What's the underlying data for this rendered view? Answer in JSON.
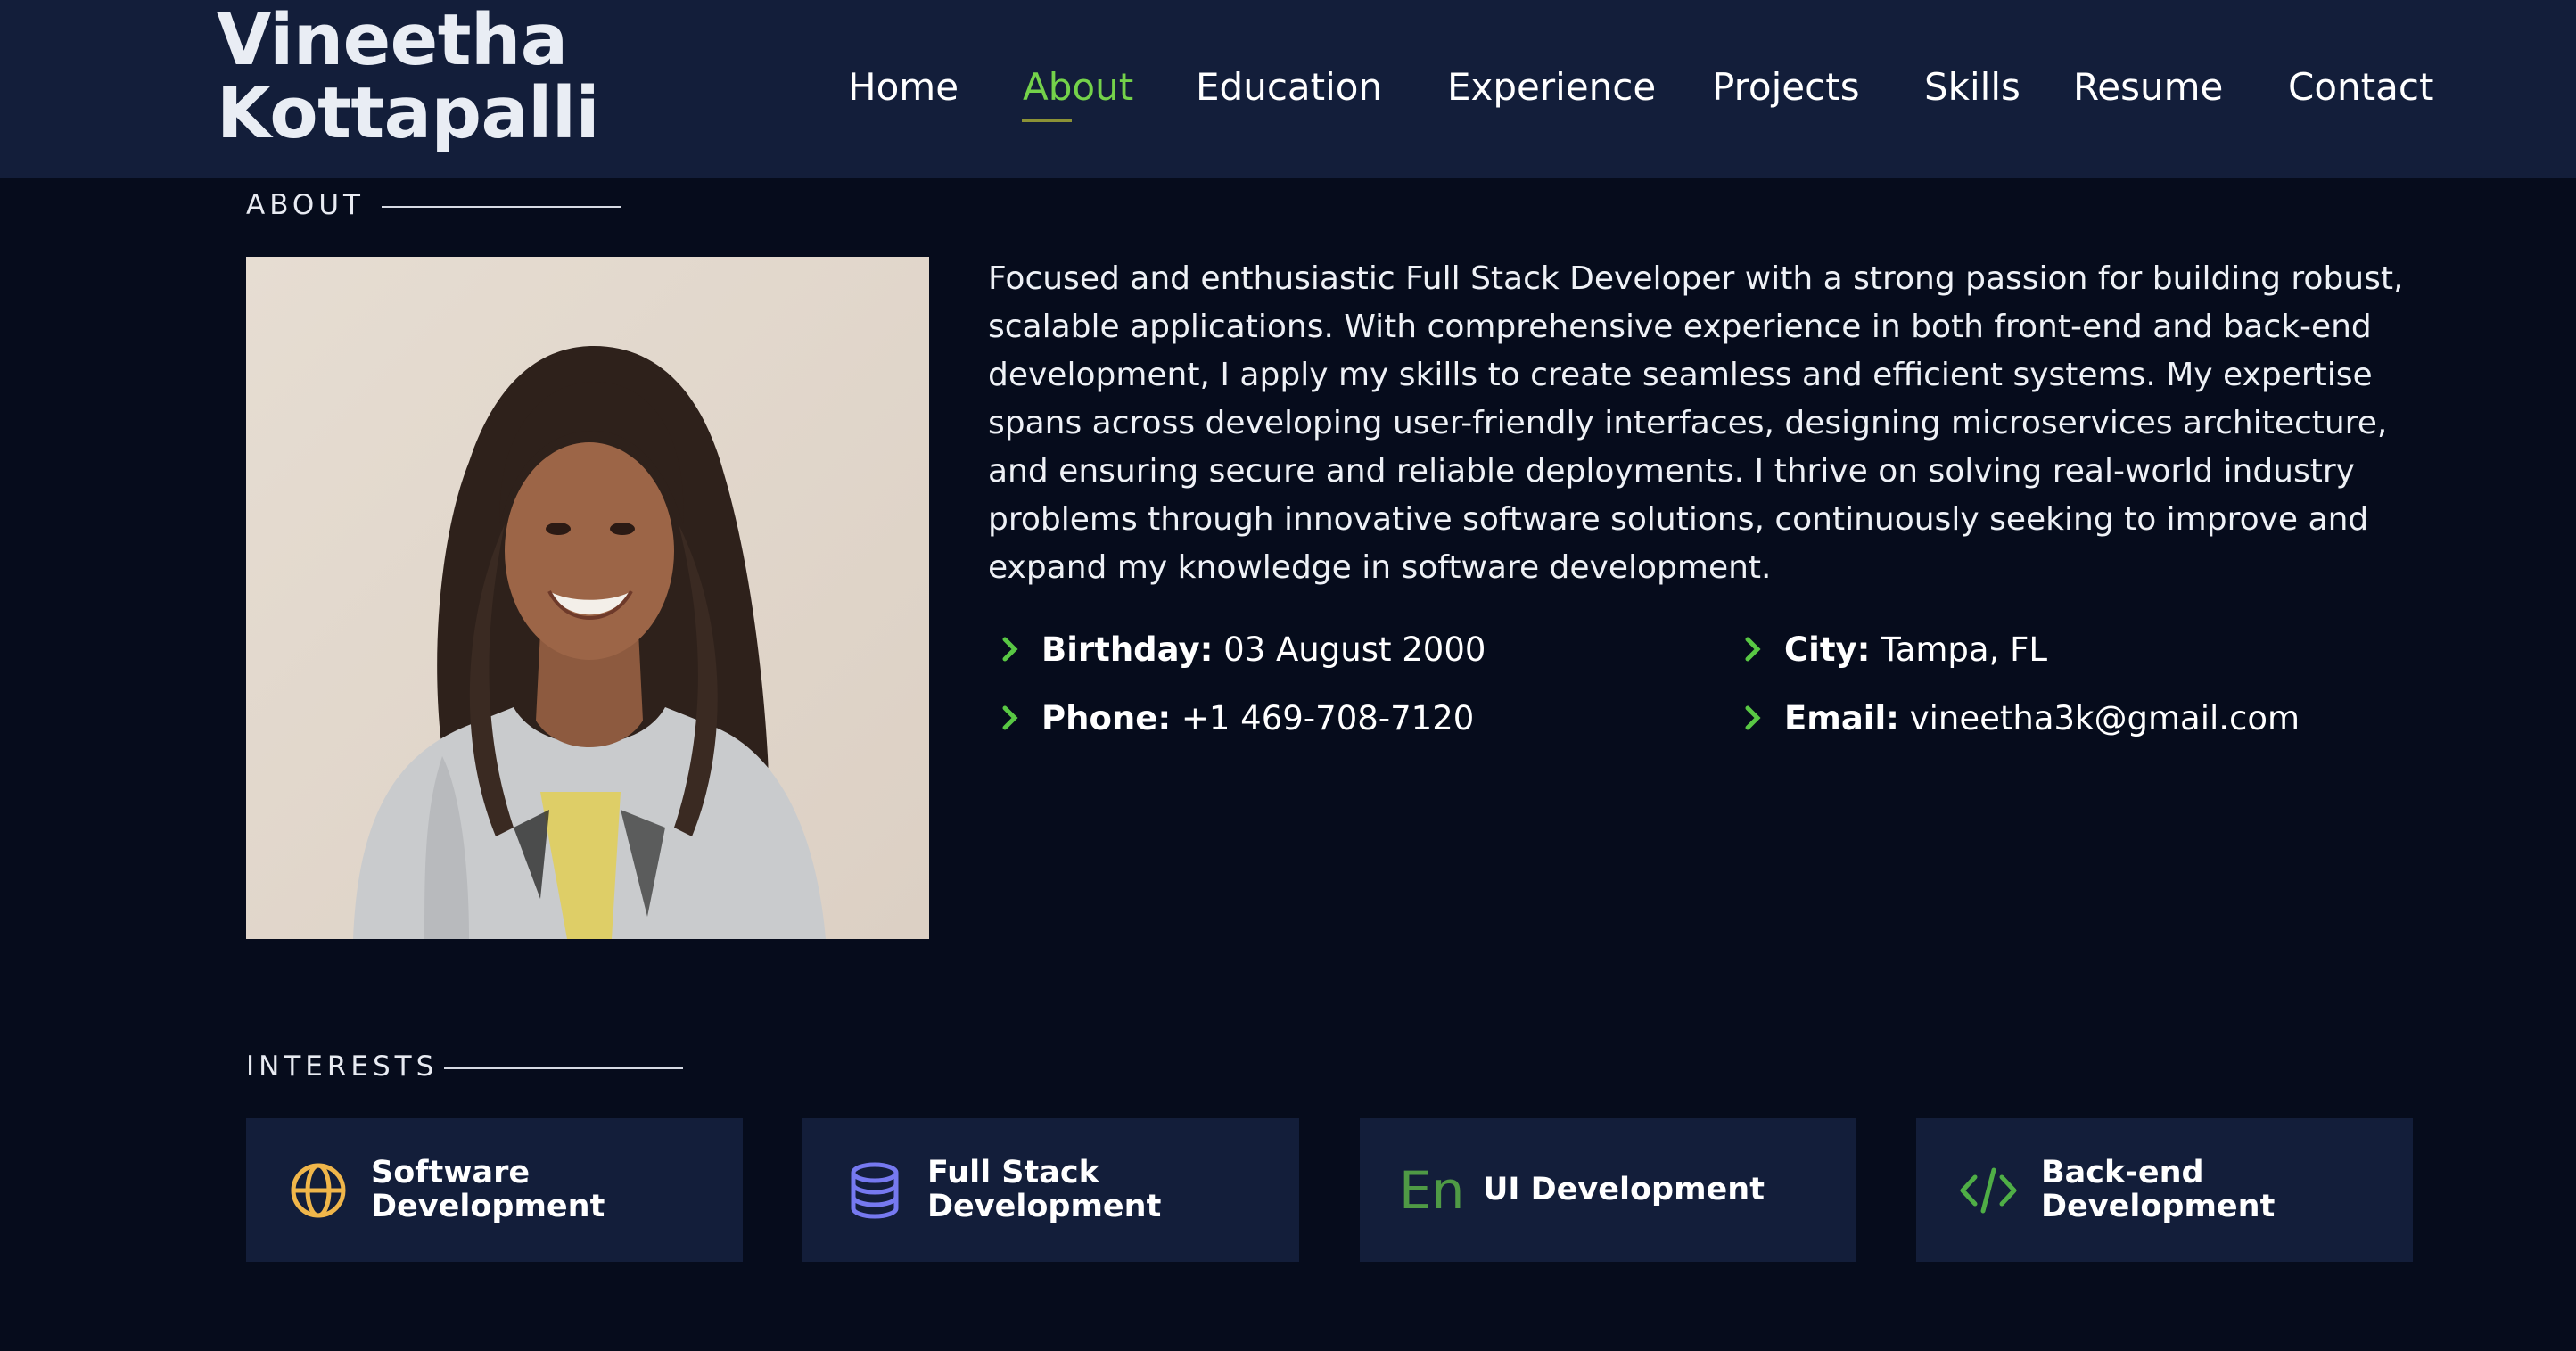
{
  "site": {
    "name_line1": "Vineetha",
    "name_line2": "Kottapalli"
  },
  "nav": {
    "items": [
      {
        "label": "Home"
      },
      {
        "label": "About",
        "active": true
      },
      {
        "label": "Education"
      },
      {
        "label": "Experience"
      },
      {
        "label": "Projects"
      },
      {
        "label": "Skills"
      },
      {
        "label": "Resume"
      },
      {
        "label": "Contact"
      }
    ],
    "active_color": "#74d24a"
  },
  "about": {
    "section_title": "ABOUT",
    "bio": "Focused and enthusiastic Full Stack Developer with a strong passion for building robust, scalable applications. With comprehensive experience in both front-end and back-end development, I apply my skills to create seamless and efficient systems. My expertise spans across developing user-friendly interfaces, designing microservices architecture, and ensuring secure and reliable deployments. I thrive on solving real-world industry problems through innovative software solutions, continuously seeking to improve and expand my knowledge in software development.",
    "details": [
      {
        "label": "Birthday:",
        "value": "03 August 2000"
      },
      {
        "label": "City:",
        "value": "Tampa, FL"
      },
      {
        "label": "Phone:",
        "value": "+1 469-708-7120"
      },
      {
        "label": "Email:",
        "value": "vineetha3k@gmail.com"
      }
    ],
    "chevron_color": "#59c844"
  },
  "interests": {
    "section_title": "INTERESTS",
    "items": [
      {
        "label": "Software Development",
        "icon": "globe-icon",
        "color": "#f0b64a"
      },
      {
        "label": "Full Stack Development",
        "icon": "database-icon",
        "color": "#7679f0"
      },
      {
        "label": "UI Development",
        "icon": "language-en-icon",
        "icon_text": "En",
        "color": "#4f9a45"
      },
      {
        "label": "Back-end Development",
        "icon": "code-icon",
        "color": "#4fae46"
      }
    ]
  }
}
